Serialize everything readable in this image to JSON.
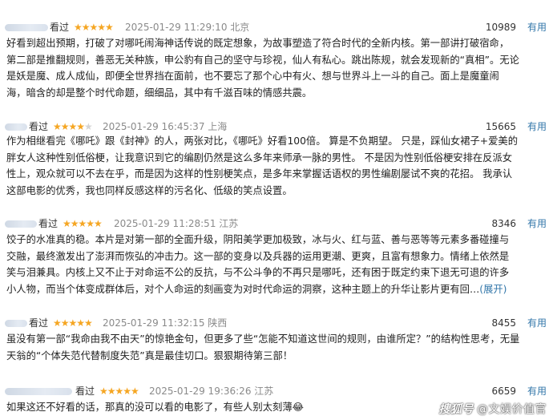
{
  "reviews": [
    {
      "seen": "看过",
      "stars": 5,
      "date": "2025-01-29 11:29:10",
      "location": "北京",
      "count": "10989",
      "useful": "有用",
      "text": "好看到超出预期，打破了对哪吒闹海神话传说的既定想象，为故事塑造了符合时代的全新内核。第一部讲打破宿命，\n第二部是推翻规则，善恶无关种族，申公豹有自己的坚守与珍视，仙人有私心。跳出陈规，就会发现新的“真相”。无论\n是妖是魔、成人成仙，即便全世界挡在面前，也不要忘了那个心中有火、想与世界斗上一斗的自己。面上是魔童闹\n海，暗含的却是整个时代命题，细细品，其中有千滋百味的情感共震。"
    },
    {
      "seen": "看过",
      "stars": 4,
      "date": "2025-01-29 16:45:37",
      "location": "上海",
      "count": "15665",
      "useful": "有用",
      "text": "作为相继看完《哪吒》跟《封神》的人，两张对比，《哪吒》好看100倍。 算是不负期望。 只是，踩仙女裙子+爱美的\n胖女人这种性别低俗梗，让我意识到它的编剧仍然是这么多年来师承一脉的男性。 不是因为性别低俗梗安排在反派女\n性上，观众就可以不去在乎，而是因为这样的性别梗笑点，是多年来掌握话语权的男性编剧屡试不爽的花招。 我承认\n这部电影的优秀，我也同样反感这样的污名化、低级的笑点设置。"
    },
    {
      "seen": "看过",
      "stars": 5,
      "date": "2025-01-29 11:28:51",
      "location": "江苏",
      "count": "8346",
      "useful": "有用",
      "text": "饺子的水准真的稳。本片是对第一部的全面升级，阴阳美学更加极致，冰与火、红与蓝、善与恶等等元素多番碰撞与\n交融，最终激发出了澎湃而恢弘的冲击力。这一部的变身以及兵器的运用更潮、更爽，且富有想象力。情绪上依然是\n笑与泪兼具。内核上又不止于对命运不公的反抗，与不公斗争的不再只是哪吒，还有困于既定约束下退无可退的许多\n小人物，而当个体变成群体后，对个人命运的刻画变为对时代命运的洞察，这种主题上的升华让影片更有回…",
      "expand": "(展开)"
    },
    {
      "seen": "看过",
      "stars": 5,
      "date": "2025-01-29 11:32:15",
      "location": "陕西",
      "count": "8455",
      "useful": "有用",
      "text": "虽没有第一部“我命由我不由天”的惊艳金句，但更多了些“怎能不知道这世间的规则，由谁所定？”的结构性思考，无量\n天翁的“个体失范代替制度失范”真是最佳切口。狠狠期待第三部！"
    },
    {
      "seen": "看过",
      "stars": 5,
      "date": "2025-01-29 19:36:26",
      "location": "江苏",
      "count": "6659",
      "useful": "有用",
      "text": "如果这还不好看的话，那真的没可以看的电影了，有些人别太刻薄😂"
    }
  ],
  "watermark": {
    "mark": "搜狐号",
    "account": "@文娱价值官"
  }
}
